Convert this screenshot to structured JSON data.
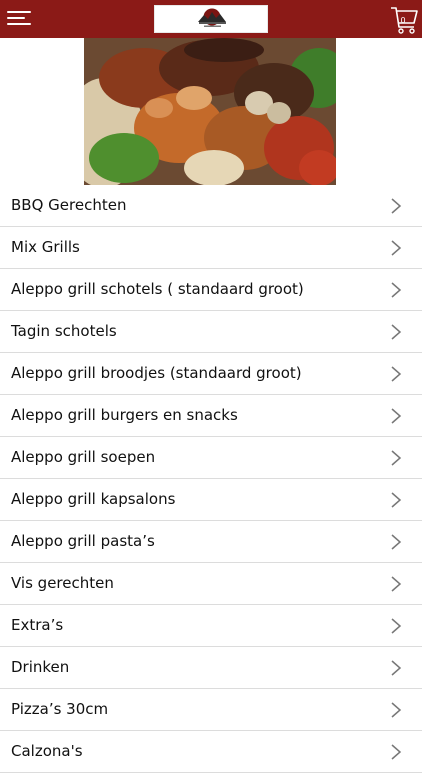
{
  "header": {
    "menu_icon": "hamburger-icon",
    "cart_icon": "shopping-cart-icon",
    "cart_count": "0",
    "brand_color": "#8b1a17"
  },
  "hero": {
    "description_icon": "grilled-meat-platter-image"
  },
  "categories": [
    "BBQ Gerechten",
    "Mix Grills",
    "Aleppo grill schotels ( standaard groot)",
    "Tagin schotels",
    "Aleppo grill broodjes (standaard groot)",
    "Aleppo grill burgers en snacks",
    "Aleppo grill soepen",
    "Aleppo grill kapsalons",
    "Aleppo grill pasta’s",
    "Vis gerechten",
    "Extra’s",
    "Drinken",
    "Pizza’s 30cm",
    "Calzona's"
  ]
}
